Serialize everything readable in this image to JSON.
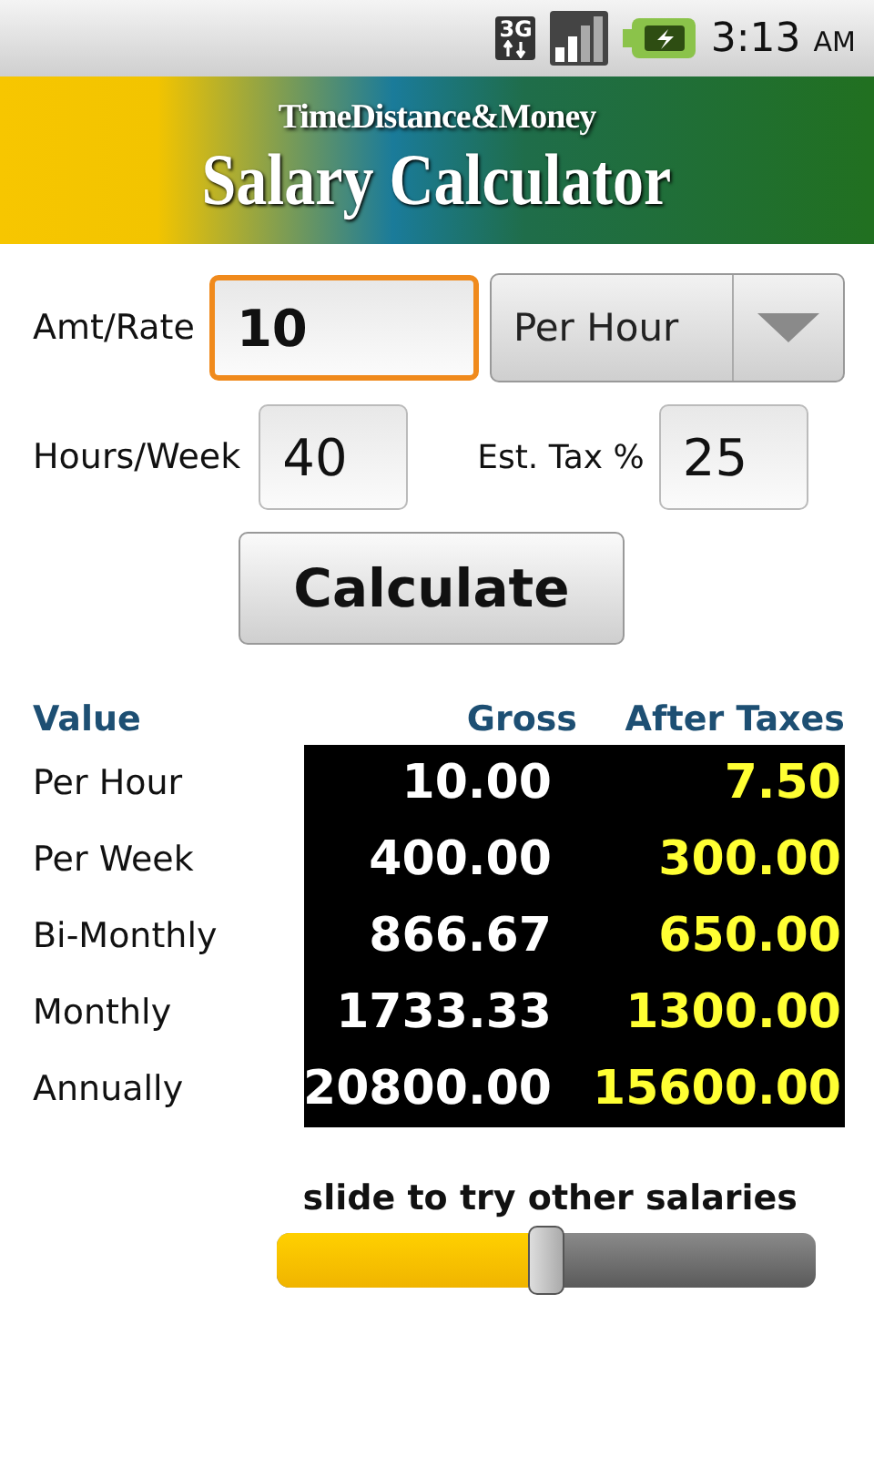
{
  "status_bar": {
    "network": "3G",
    "time": "3:13",
    "ampm": "AM"
  },
  "banner": {
    "brand": "TimeDistance&Money",
    "title": "Salary Calculator"
  },
  "form": {
    "amount": {
      "label": "Amt/Rate",
      "value": "10",
      "focused": true
    },
    "period": {
      "value": "Per Hour"
    },
    "hours": {
      "label": "Hours/Week",
      "value": "40",
      "focused": false
    },
    "tax": {
      "label": "Est. Tax %",
      "value": "25",
      "focused": false
    },
    "calculate_button": "Calculate"
  },
  "table": {
    "columns": [
      "Value",
      "Gross",
      "After Taxes"
    ],
    "rows": [
      {
        "label": "Per Hour",
        "gross": "10.00",
        "after_taxes": "7.50"
      },
      {
        "label": "Per Week",
        "gross": "400.00",
        "after_taxes": "300.00"
      },
      {
        "label": "Bi-Monthly",
        "gross": "866.67",
        "after_taxes": "650.00"
      },
      {
        "label": "Monthly",
        "gross": "1733.33",
        "after_taxes": "1300.00"
      },
      {
        "label": "Annually",
        "gross": "20800.00",
        "after_taxes": "15600.00"
      }
    ]
  },
  "slider": {
    "caption": "slide to try other salaries",
    "level": 0.5
  }
}
